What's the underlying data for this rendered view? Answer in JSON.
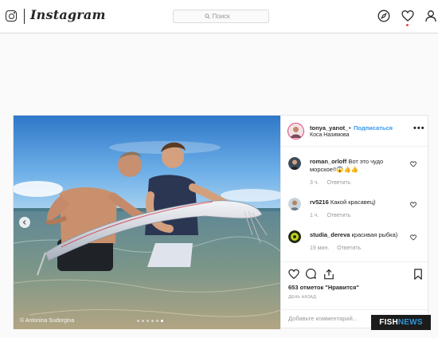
{
  "nav": {
    "wordmark": "Instagram",
    "search_placeholder": "Поиск",
    "icons": [
      "instagram-logo-icon",
      "search-icon",
      "compass-icon",
      "heart-icon",
      "profile-icon"
    ]
  },
  "post": {
    "username": "tonya_yanot_",
    "bullet": "•",
    "follow_label": "Подписаться",
    "location": "Коса Назимова",
    "more": "•••",
    "photo_credit": "© Antonina Sudorgina",
    "carousel_dots": 6,
    "comments": [
      {
        "user": "roman_orloff",
        "text": "Вот это чудо морское!!😱👍👍",
        "time": "3 ч.",
        "reply_label": "Ответить"
      },
      {
        "user": "rv5216",
        "text": "Какой красавец)",
        "time": "1 ч.",
        "reply_label": "Ответить"
      },
      {
        "user": "studia_dereva",
        "text": "красивая рыбка)",
        "time": "19 мин.",
        "reply_label": "Ответить"
      }
    ],
    "likes": "653 отметок \"Нравится\"",
    "posted": "день назад",
    "add_comment_placeholder": "Добавьте комментарий..."
  },
  "watermark": {
    "part1": "FISH",
    "part2": "NEWS"
  },
  "colors": {
    "follow": "#3897f0",
    "border": "#dbdbdb",
    "muted": "#999999",
    "background": "#fafafa"
  }
}
